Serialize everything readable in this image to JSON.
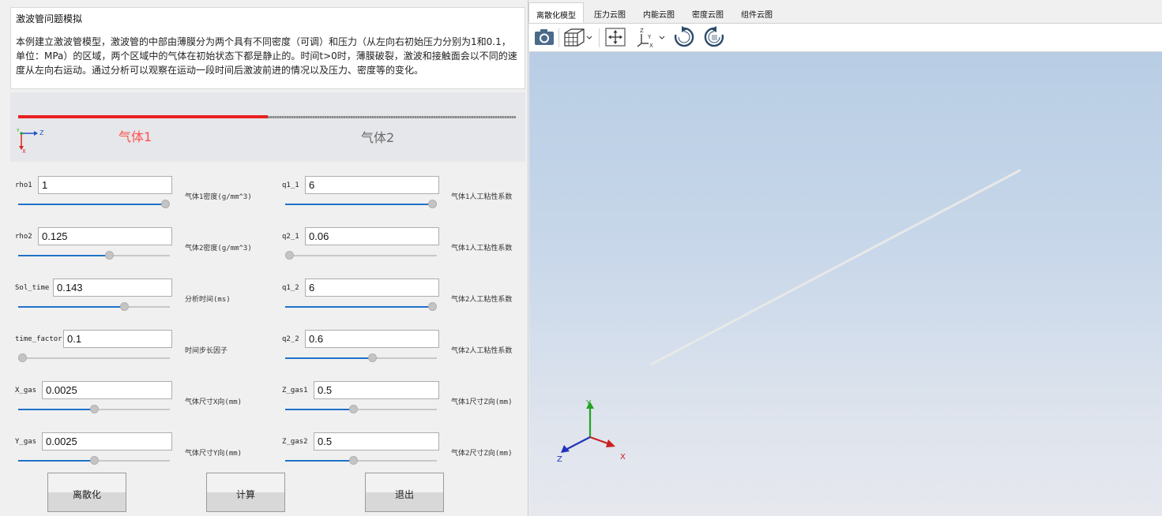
{
  "description": {
    "title": "激波管问题模拟",
    "body": "本例建立激波管模型，激波管的中部由薄膜分为两个具有不同密度（可调）和压力（从左向右初始压力分别为1和0.1，单位：MPa）的区域，两个区域中的气体在初始状态下都是静止的。时间t>0时，薄膜破裂，激波和接触面会以不同的速度从左向右运动。通过分析可以观察在运动一段时间后激波前进的情况以及压力、密度等的变化。"
  },
  "schematic": {
    "gas1_label": "气体1",
    "gas2_label": "气体2",
    "axis_y": "Y",
    "axis_z": "Z",
    "axis_x": "X"
  },
  "params_left": [
    {
      "name": "rho1",
      "value": "1",
      "desc": "气体1密度(g/mm^3)",
      "level": 1.0
    },
    {
      "name": "rho2",
      "value": "0.125",
      "desc": "气体2密度(g/mm^3)",
      "level": 0.61
    },
    {
      "name": "Sol_time",
      "value": "0.143",
      "desc": "分析时间(ms)",
      "level": 0.71
    },
    {
      "name": "time_factor",
      "value": "0.1",
      "desc": "时间步长因子",
      "level": 0.0
    },
    {
      "name": "X_gas",
      "value": "0.0025",
      "desc": "气体尺寸X向(mm)",
      "level": 0.5
    },
    {
      "name": "Y_gas",
      "value": "0.0025",
      "desc": "气体尺寸Y向(mm)",
      "level": 0.5
    }
  ],
  "params_right": [
    {
      "name": "q1_1",
      "value": "6",
      "desc": "气体1人工粘性系数",
      "level": 1.0
    },
    {
      "name": "q2_1",
      "value": "0.06",
      "desc": "气体1人工粘性系数",
      "level": 0.0
    },
    {
      "name": "q1_2",
      "value": "6",
      "desc": "气体2人工粘性系数",
      "level": 1.0
    },
    {
      "name": "q2_2",
      "value": "0.6",
      "desc": "气体2人工粘性系数",
      "level": 0.58
    },
    {
      "name": "Z_gas1",
      "value": "0.5",
      "desc": "气体1尺寸Z向(mm)",
      "level": 0.45
    },
    {
      "name": "Z_gas2",
      "value": "0.5",
      "desc": "气体2尺寸Z向(mm)",
      "level": 0.45
    }
  ],
  "buttons": {
    "discretize": "离散化",
    "compute": "计算",
    "exit": "退出"
  },
  "tabs": [
    "离散化模型",
    "压力云图",
    "内能云图",
    "密度云图",
    "组件云图"
  ],
  "active_tab": 0,
  "toolbar": [
    "camera-icon",
    "view-cube-icon",
    "fit-view-icon",
    "axes-orient-icon",
    "rotate-cw-icon",
    "rotate-ccw-icon"
  ],
  "triad": {
    "x": "X",
    "y": "Y",
    "z": "Z"
  },
  "colors": {
    "red_tube": "#e82222",
    "gas1_text": "#ff5050",
    "slider_fill": "#1e72c8"
  }
}
